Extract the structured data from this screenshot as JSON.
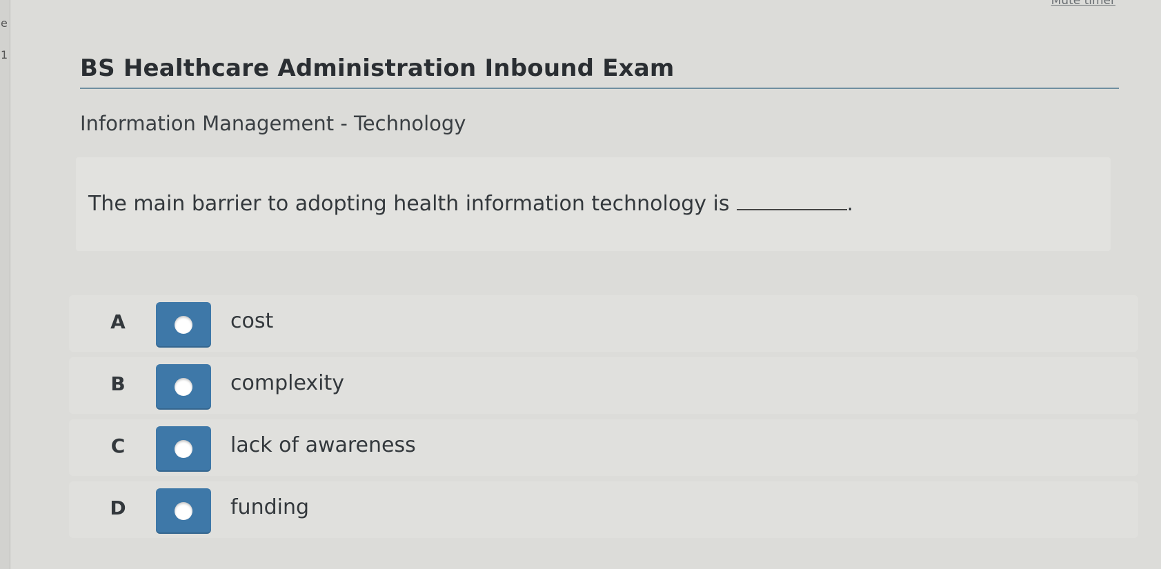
{
  "header": {
    "mute_timer_label": "Mute timer",
    "title": "BS Healthcare Administration Inbound Exam"
  },
  "section": {
    "label": "Information Management - Technology"
  },
  "question": {
    "text": "The main barrier to adopting health information technology is",
    "end_punctuation": "."
  },
  "options": [
    {
      "letter": "A",
      "text": "cost"
    },
    {
      "letter": "B",
      "text": "complexity"
    },
    {
      "letter": "C",
      "text": "lack of awareness"
    },
    {
      "letter": "D",
      "text": "funding"
    }
  ],
  "colors": {
    "accent": "#3e78a8",
    "background": "#dcdcd9",
    "rule": "#6f8fa0"
  }
}
